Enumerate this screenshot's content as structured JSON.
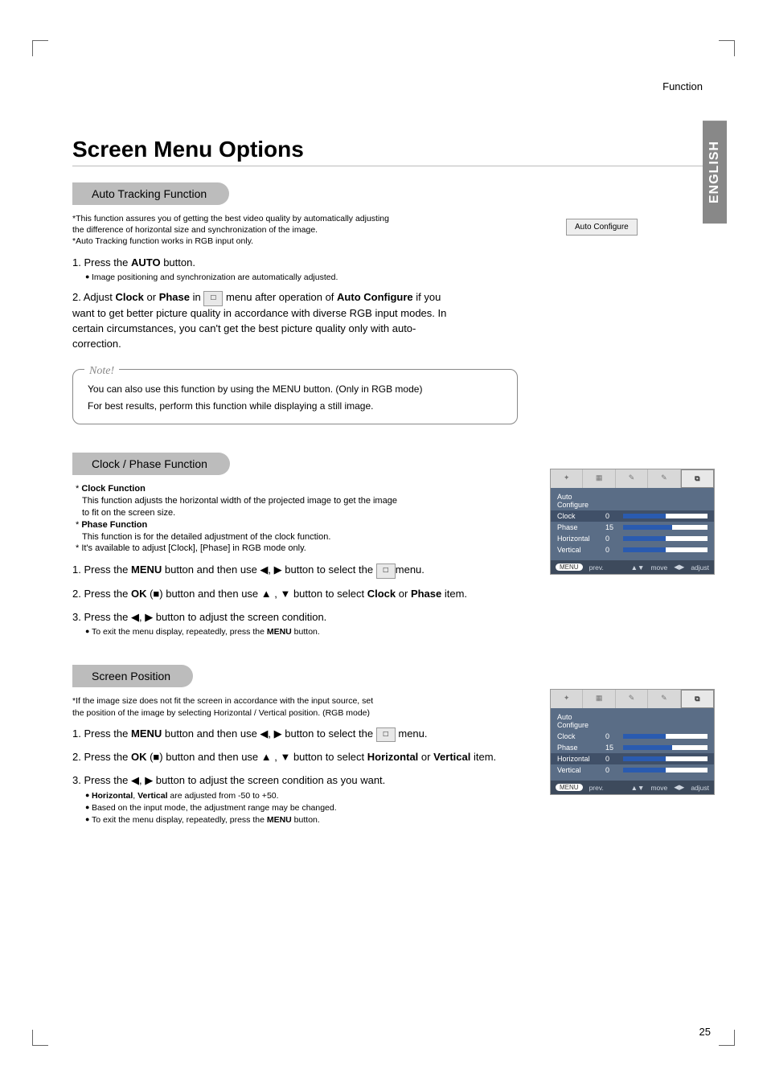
{
  "header_func": "Function",
  "tab_lang": "ENGLISH",
  "title": "Screen Menu Options",
  "sec1": {
    "heading": "Auto Tracking Function",
    "note1": "*This function assures you of getting the best video quality by automatically adjusting the difference of horizontal size and synchronization of the image.",
    "note2": "*Auto Tracking function works in RGB input only.",
    "s1_pre": "1. Press the ",
    "s1_b": "AUTO",
    "s1_post": " button.",
    "s1_bul": "Image positioning and synchronization are automatically adjusted.",
    "s2_pre": "2. Adjust ",
    "s2_b1": "Clock",
    "s2_mid1": " or ",
    "s2_b2": "Phase",
    "s2_mid2": " in ",
    "s2_icon": "□",
    "s2_mid3": "  menu after operation of ",
    "s2_b3": "Auto Configure",
    "s2_post": " if you want to get better picture quality in accordance with diverse RGB input modes. In certain circumstances, you can't get the best picture quality only with auto-correction.",
    "auto_btn": "Auto Configure",
    "note_title": "Note!",
    "note_l1": "You can also use this function by using the MENU button. (Only in RGB mode)",
    "note_l2": "For best results, perform this function while displaying a still image."
  },
  "sec2": {
    "heading": "Clock / Phase Function",
    "d1a": "* ",
    "d1b": "Clock Function",
    "d1c": "This function adjusts the horizontal width of the projected image to get the image to fit on the screen size.",
    "d2a": "* ",
    "d2b": "Phase Function",
    "d2c": "This function is for the detailed adjustment of the clock function.",
    "d3": "* It's available to adjust [Clock], [Phase] in RGB mode only.",
    "s1_pre": "1. Press the ",
    "s1_b": "MENU",
    "s1_mid": " button and then use ◀, ▶ button to select the ",
    "s1_post": "menu.",
    "s2_pre": "2. Press the ",
    "s2_b1": "OK",
    "s2_mid1": " (■) button and then use ▲ , ▼ button to select ",
    "s2_b2": "Clock",
    "s2_mid2": " or ",
    "s2_b3": "Phase",
    "s2_post": " item.",
    "s3": "3. Press the ◀, ▶ button to adjust the screen condition.",
    "s3_bul_pre": "To exit the menu display, repeatedly, press the ",
    "s3_bul_b": "MENU",
    "s3_bul_post": " button."
  },
  "sec3": {
    "heading": "Screen Position",
    "note": "*If the image size does not fit the screen in accordance with the input source, set the position of the image by selecting Horizontal / Vertical position. (RGB mode)",
    "s1_pre": "1. Press the ",
    "s1_b": "MENU",
    "s1_mid": " button and then use ◀, ▶ button to select the ",
    "s1_post": " menu.",
    "s2_pre": "2. Press the ",
    "s2_b1": "OK",
    "s2_mid1": " (■) button and then use ▲ , ▼ button to select ",
    "s2_b2": "Horizontal",
    "s2_mid2": " or ",
    "s2_b3": "Vertical",
    "s2_post": " item.",
    "s3": "3. Press the ◀, ▶ button to adjust the screen condition as you want.",
    "b1_b": "Horizontal",
    "b1_mid": ", ",
    "b1_b2": "Vertical",
    "b1_post": " are adjusted from -50 to +50.",
    "b2": "Based on the input mode, the adjustment range may be changed.",
    "b3_pre": "To exit the menu display, repeatedly, press the ",
    "b3_b": "MENU",
    "b3_post": " button."
  },
  "osd": {
    "auto": "Auto Configure",
    "clock": "Clock",
    "clock_v": "0",
    "phase": "Phase",
    "phase_v": "15",
    "horiz": "Horizontal",
    "horiz_v": "0",
    "vert": "Vertical",
    "vert_v": "0",
    "menu": "MENU",
    "prev": "prev.",
    "move": "move",
    "adjust": "adjust"
  },
  "pagenum": "25"
}
